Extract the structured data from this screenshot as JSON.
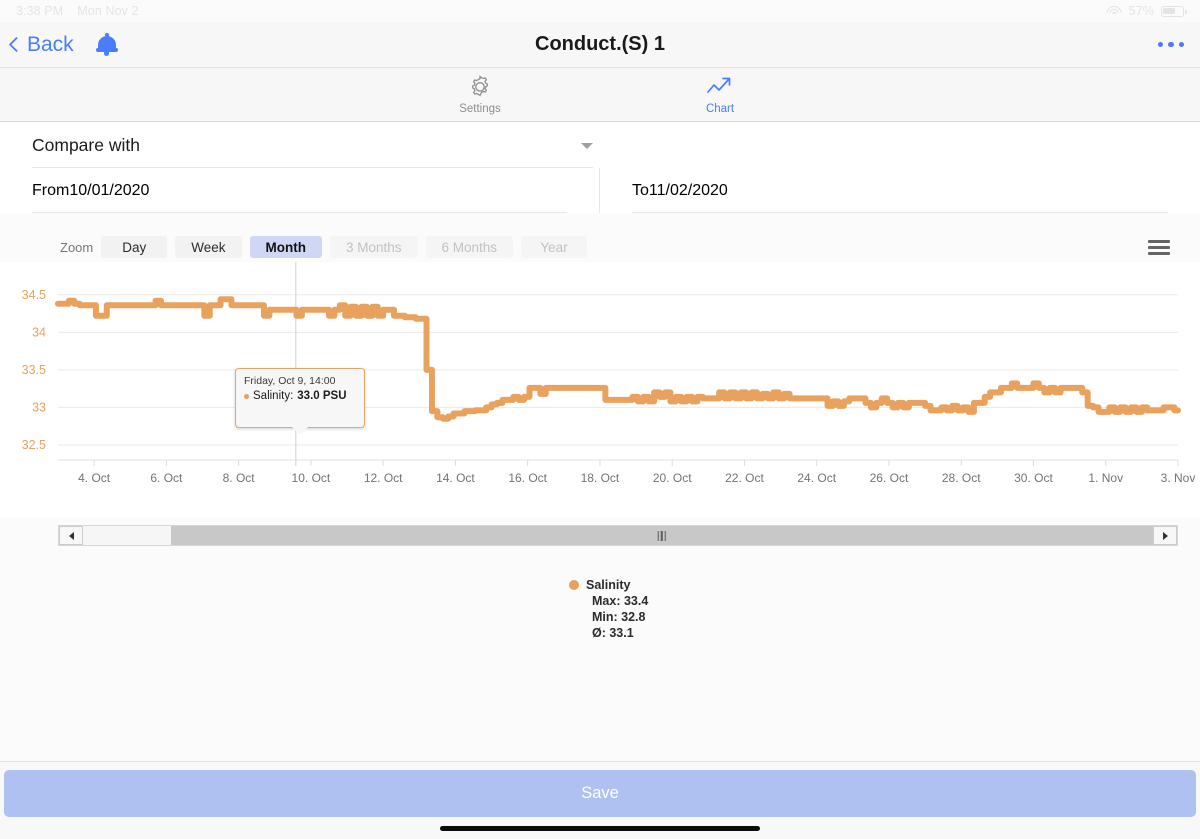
{
  "status_bar": {
    "time": "3:38 PM",
    "date": "Mon Nov 2",
    "battery": "57%",
    "wifi_icon": "wifi-icon",
    "battery_icon": "battery-icon"
  },
  "nav": {
    "back_label": "Back",
    "title": "Conduct.(S) 1",
    "bell_icon": "bell-icon",
    "more_icon": "more-options-icon",
    "back_icon": "chevron-left-icon"
  },
  "tabs": [
    {
      "label": "Settings",
      "icon": "gear-icon",
      "active": false
    },
    {
      "label": "Chart",
      "icon": "trend-up-icon",
      "active": true
    }
  ],
  "form": {
    "compare_label": "Compare with",
    "compare_value": "",
    "compare_caret_icon": "chevron-down-icon",
    "from_label": "From",
    "from_value": "10/01/2020",
    "to_label": "To",
    "to_value": "11/02/2020"
  },
  "zoom": {
    "label": "Zoom",
    "buttons": [
      {
        "label": "Day",
        "state": "normal"
      },
      {
        "label": "Week",
        "state": "normal"
      },
      {
        "label": "Month",
        "state": "active"
      },
      {
        "label": "3 Months",
        "state": "disabled"
      },
      {
        "label": "6 Months",
        "state": "disabled"
      },
      {
        "label": "Year",
        "state": "disabled"
      }
    ],
    "menu_icon": "hamburger-menu-icon"
  },
  "tooltip": {
    "date": "Friday, Oct 9, 14:00",
    "series": "Salinity:",
    "value": "33.0 PSU",
    "marker_icon": "series-dot-icon"
  },
  "legend": {
    "series_name": "Salinity",
    "max": "Max: 33.4",
    "min": "Min: 32.8",
    "avg": "Ø: 33.1",
    "dot_icon": "series-dot-icon"
  },
  "navigator": {
    "left_arrow_icon": "scroll-left-icon",
    "right_arrow_icon": "scroll-right-icon",
    "grip_icon": "drag-grip-icon"
  },
  "footer": {
    "save_label": "Save",
    "home_indicator": "home-indicator"
  },
  "colors": {
    "series": "#e8a25e",
    "accent_blue": "#4a7dfc",
    "active_zoom_bg": "#cfd7f5",
    "save_bg": "#aec1f0",
    "axis_label": "#72727a",
    "y_axis_label": "#e8a25e"
  },
  "chart_data": {
    "type": "line",
    "title": "",
    "xlabel": "",
    "ylabel": "",
    "unit": "PSU",
    "series_name": "Salinity",
    "color": "#e8a25e",
    "ylim": [
      32.3,
      34.75
    ],
    "yticks": [
      32.5,
      33,
      33.5,
      34,
      34.5
    ],
    "ytick_labels": [
      "32.5",
      "33",
      "33.5",
      "34",
      "34.5"
    ],
    "grid": true,
    "legend_position": "bottom-center",
    "xticks": [
      "4. Oct",
      "6. Oct",
      "8. Oct",
      "10. Oct",
      "12. Oct",
      "14. Oct",
      "16. Oct",
      "18. Oct",
      "20. Oct",
      "22. Oct",
      "24. Oct",
      "26. Oct",
      "28. Oct",
      "30. Oct",
      "1. Nov",
      "3. Nov"
    ],
    "x_range": [
      "2020-10-03",
      "2020-11-03"
    ],
    "crosshair_x": "2020-10-09 14:00",
    "stats": {
      "max": 33.4,
      "min": 32.8,
      "avg": 33.1
    },
    "x": [
      3.0,
      3.15,
      3.3,
      3.45,
      3.6,
      3.75,
      3.9,
      4.05,
      4.2,
      4.35,
      4.5,
      4.65,
      4.8,
      4.95,
      5.1,
      5.25,
      5.4,
      5.55,
      5.7,
      5.85,
      6.0,
      6.15,
      6.3,
      6.45,
      6.6,
      6.75,
      6.9,
      7.05,
      7.2,
      7.35,
      7.5,
      7.65,
      7.8,
      7.95,
      8.1,
      8.25,
      8.4,
      8.55,
      8.7,
      8.85,
      9.0,
      9.15,
      9.3,
      9.45,
      9.6,
      9.75,
      9.9,
      10.05,
      10.2,
      10.35,
      10.5,
      10.65,
      10.8,
      10.95,
      11.1,
      11.25,
      11.4,
      11.55,
      11.7,
      11.85,
      12.0,
      12.15,
      12.3,
      12.45,
      12.6,
      12.75,
      12.9,
      13.05,
      13.2,
      13.35,
      13.5,
      13.65,
      13.8,
      13.95,
      14.1,
      14.25,
      14.4,
      14.55,
      14.7,
      14.85,
      15.0,
      15.15,
      15.3,
      15.45,
      15.6,
      15.75,
      15.9,
      16.05,
      16.2,
      16.35,
      16.5,
      16.65,
      16.8,
      16.95,
      17.1,
      17.25,
      17.4,
      17.55,
      17.7,
      17.85,
      18.0,
      18.15,
      18.3,
      18.45,
      18.6,
      18.75,
      18.9,
      19.05,
      19.2,
      19.35,
      19.5,
      19.65,
      19.8,
      19.95,
      20.1,
      20.25,
      20.4,
      20.55,
      20.7,
      20.85,
      21.0,
      21.15,
      21.3,
      21.45,
      21.6,
      21.75,
      21.9,
      22.05,
      22.2,
      22.35,
      22.5,
      22.65,
      22.8,
      22.95,
      23.1,
      23.25,
      23.4,
      23.55,
      23.7,
      23.85,
      24.0,
      24.15,
      24.3,
      24.45,
      24.6,
      24.75,
      24.9,
      25.05,
      25.2,
      25.35,
      25.5,
      25.65,
      25.8,
      25.95,
      26.1,
      26.25,
      26.4,
      26.55,
      26.7,
      26.85,
      27.0,
      27.15,
      27.3,
      27.45,
      27.6,
      27.75,
      27.9,
      28.05,
      28.2,
      28.35,
      28.5,
      28.65,
      28.8,
      28.95,
      29.1,
      29.25,
      29.4,
      29.55,
      29.7,
      29.85,
      30.0,
      30.15,
      30.3,
      30.45,
      30.6,
      30.75,
      30.9,
      31.05,
      31.2,
      31.35,
      31.5,
      31.65,
      31.8,
      31.95,
      32.1,
      32.25,
      32.4,
      32.55,
      32.7,
      32.85,
      33.0,
      33.15,
      33.3,
      33.45,
      33.6,
      33.75,
      33.9,
      34.0
    ],
    "values": [
      34.38,
      34.38,
      34.42,
      34.38,
      34.36,
      34.36,
      34.36,
      34.22,
      34.22,
      34.36,
      34.36,
      34.36,
      34.36,
      34.36,
      34.36,
      34.36,
      34.36,
      34.36,
      34.42,
      34.36,
      34.36,
      34.36,
      34.36,
      34.36,
      34.36,
      34.36,
      34.36,
      34.22,
      34.36,
      34.36,
      34.44,
      34.44,
      34.36,
      34.36,
      34.36,
      34.36,
      34.36,
      34.36,
      34.22,
      34.3,
      34.3,
      34.3,
      34.3,
      34.3,
      34.22,
      34.3,
      34.3,
      34.3,
      34.3,
      34.3,
      34.22,
      34.3,
      34.36,
      34.22,
      34.34,
      34.22,
      34.34,
      34.22,
      34.34,
      34.22,
      34.3,
      34.3,
      34.22,
      34.22,
      34.2,
      34.2,
      34.18,
      34.18,
      33.5,
      32.95,
      32.87,
      32.85,
      32.88,
      32.92,
      32.92,
      32.95,
      32.95,
      32.96,
      32.96,
      33.0,
      33.04,
      33.06,
      33.1,
      33.1,
      33.14,
      33.1,
      33.14,
      33.26,
      33.26,
      33.18,
      33.26,
      33.26,
      33.26,
      33.26,
      33.26,
      33.26,
      33.26,
      33.26,
      33.26,
      33.26,
      33.26,
      33.1,
      33.1,
      33.1,
      33.1,
      33.1,
      33.14,
      33.08,
      33.14,
      33.08,
      33.2,
      33.14,
      33.2,
      33.08,
      33.14,
      33.08,
      33.14,
      33.08,
      33.14,
      33.12,
      33.12,
      33.12,
      33.2,
      33.12,
      33.2,
      33.12,
      33.2,
      33.12,
      33.2,
      33.12,
      33.18,
      33.12,
      33.2,
      33.12,
      33.18,
      33.12,
      33.12,
      33.12,
      33.12,
      33.12,
      33.12,
      33.12,
      33.02,
      33.08,
      33.02,
      33.08,
      33.12,
      33.12,
      33.12,
      33.06,
      33.0,
      33.06,
      33.12,
      33.06,
      33.0,
      33.06,
      33.0,
      33.06,
      33.06,
      33.06,
      33.02,
      32.96,
      32.96,
      33.0,
      32.96,
      33.02,
      32.96,
      33.0,
      32.94,
      33.06,
      33.06,
      33.14,
      33.2,
      33.2,
      33.26,
      33.26,
      33.32,
      33.26,
      33.26,
      33.26,
      33.32,
      33.26,
      33.2,
      33.26,
      33.2,
      33.26,
      33.26,
      33.26,
      33.26,
      33.2,
      33.02,
      33.0,
      32.94,
      32.94,
      33.0,
      32.94,
      33.0,
      32.94,
      33.0,
      32.94,
      33.0,
      32.96,
      32.96,
      32.96,
      33.0,
      33.0,
      32.96,
      32.96,
      32.92,
      32.9
    ]
  }
}
